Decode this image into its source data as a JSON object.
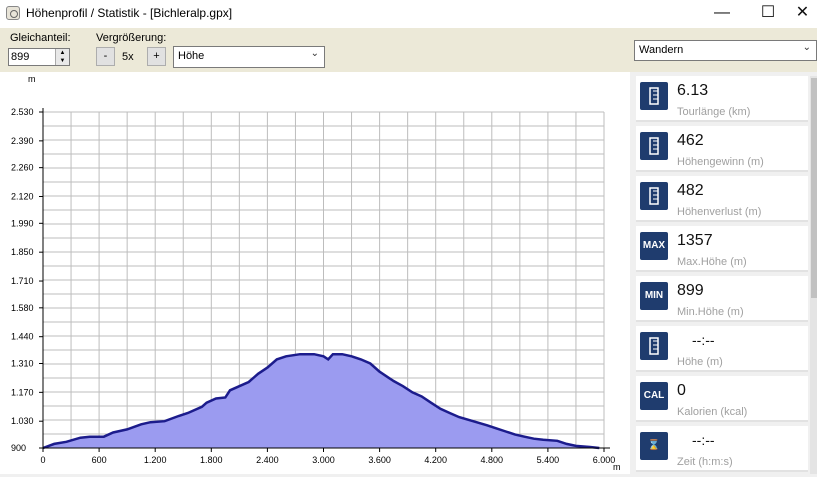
{
  "window": {
    "title": "Höhenprofil / Statistik - [Bichleralp.gpx]",
    "min": "—",
    "max": "☐",
    "close": "✕"
  },
  "toolbar": {
    "offset_label": "Gleichanteil:",
    "offset_value": "899",
    "zoom_label": "Vergrößerung:",
    "zoom_minus": "-",
    "zoom_value": "5x",
    "zoom_plus": "+",
    "y_select": "Höhe",
    "activity_select": "Wandern"
  },
  "chart_data": {
    "type": "area",
    "ylabel": "m",
    "xlabel": "m",
    "xlim": [
      0,
      6000
    ],
    "ylim": [
      900,
      2530
    ],
    "xticks": [
      0,
      600,
      1200,
      1800,
      2400,
      3000,
      3600,
      4200,
      4800,
      5400,
      6000
    ],
    "xtick_labels": [
      "0",
      "600",
      "1.200",
      "1.800",
      "2.400",
      "3.000",
      "3.600",
      "4.200",
      "4.800",
      "5.400",
      "6.000"
    ],
    "yticks": [
      900,
      1030,
      1170,
      1310,
      1440,
      1580,
      1710,
      1850,
      1990,
      2120,
      2260,
      2390,
      2530
    ],
    "ytick_labels": [
      "900",
      "1.030",
      "1.170",
      "1.310",
      "1.440",
      "1.580",
      "1.710",
      "1.850",
      "1.990",
      "2.120",
      "2.260",
      "2.390",
      "2.530"
    ],
    "grid": true,
    "fill_color": "#9b9bf0",
    "line_color": "#1c1c8c",
    "x": [
      0,
      120,
      250,
      400,
      500,
      650,
      750,
      900,
      1050,
      1150,
      1300,
      1450,
      1550,
      1700,
      1750,
      1850,
      1950,
      2000,
      2100,
      2200,
      2300,
      2400,
      2500,
      2600,
      2750,
      2900,
      3000,
      3050,
      3100,
      3200,
      3300,
      3400,
      3500,
      3600,
      3700,
      3750,
      3850,
      3950,
      4050,
      4150,
      4250,
      4350,
      4450,
      4600,
      4750,
      4850,
      4950,
      5050,
      5150,
      5250,
      5350,
      5500,
      5600,
      5700,
      5850,
      5950
    ],
    "y": [
      900,
      920,
      930,
      950,
      955,
      955,
      975,
      990,
      1015,
      1025,
      1030,
      1055,
      1070,
      1100,
      1120,
      1140,
      1145,
      1180,
      1200,
      1220,
      1260,
      1290,
      1330,
      1345,
      1355,
      1355,
      1345,
      1330,
      1355,
      1355,
      1345,
      1330,
      1310,
      1270,
      1240,
      1225,
      1200,
      1170,
      1150,
      1120,
      1090,
      1070,
      1050,
      1030,
      1010,
      995,
      980,
      965,
      955,
      945,
      940,
      935,
      920,
      910,
      905,
      900
    ]
  },
  "stats": [
    {
      "icon": "route-icon",
      "value": "6.13",
      "label": "Tourlänge (km)"
    },
    {
      "icon": "elevation-gain-icon",
      "value": "462",
      "label": "Höhengewinn (m)"
    },
    {
      "icon": "elevation-loss-icon",
      "value": "482",
      "label": "Höhenverlust (m)"
    },
    {
      "icon": "max-height-icon",
      "value": "1357",
      "label": "Max.Höhe (m)",
      "badge": "MAX"
    },
    {
      "icon": "min-height-icon",
      "value": "899",
      "label": "Min.Höhe (m)",
      "badge": "MIN"
    },
    {
      "icon": "height-icon",
      "value": "--:--",
      "label": "Höhe (m)"
    },
    {
      "icon": "calories-icon",
      "value": "0",
      "label": "Kalorien (kcal)",
      "badge": "CAL"
    },
    {
      "icon": "hourglass-icon",
      "value": "--:--",
      "label": "Zeit (h:m:s)",
      "badge": "⌛"
    }
  ]
}
